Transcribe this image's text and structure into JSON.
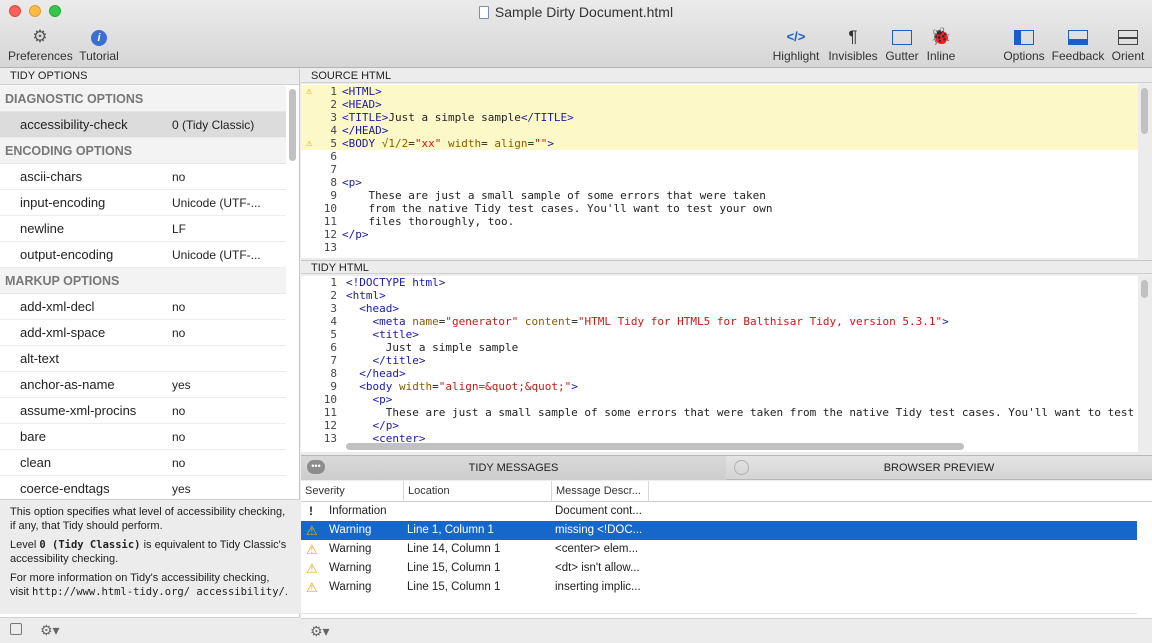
{
  "window": {
    "title": "Sample Dirty Document.html"
  },
  "toolbar": {
    "left": [
      {
        "label": "Preferences",
        "icon": "gear-icon"
      },
      {
        "label": "Tutorial",
        "icon": "info-icon"
      }
    ],
    "right": [
      {
        "label": "Highlight",
        "icon": "code-brackets-icon"
      },
      {
        "label": "Invisibles",
        "icon": "pilcrow-icon"
      },
      {
        "label": "Gutter",
        "icon": "gutter-icon"
      },
      {
        "label": "Inline",
        "icon": "bug-icon"
      },
      {
        "label": "Options",
        "icon": "options-panel-icon"
      },
      {
        "label": "Feedback",
        "icon": "feedback-panel-icon"
      },
      {
        "label": "Orient",
        "icon": "orient-icon"
      }
    ]
  },
  "left_pane": {
    "header": "TIDY OPTIONS",
    "groups": [
      {
        "title": "DIAGNOSTIC OPTIONS",
        "options": [
          {
            "name": "accessibility-check",
            "value": "0 (Tidy Classic)",
            "selected": true
          }
        ]
      },
      {
        "title": "ENCODING OPTIONS",
        "options": [
          {
            "name": "ascii-chars",
            "value": "no"
          },
          {
            "name": "input-encoding",
            "value": "Unicode (UTF-..."
          },
          {
            "name": "newline",
            "value": "LF"
          },
          {
            "name": "output-encoding",
            "value": "Unicode (UTF-..."
          }
        ]
      },
      {
        "title": "MARKUP OPTIONS",
        "options": [
          {
            "name": "add-xml-decl",
            "value": "no"
          },
          {
            "name": "add-xml-space",
            "value": "no"
          },
          {
            "name": "alt-text",
            "value": ""
          },
          {
            "name": "anchor-as-name",
            "value": "yes"
          },
          {
            "name": "assume-xml-procins",
            "value": "no"
          },
          {
            "name": "bare",
            "value": "no"
          },
          {
            "name": "clean",
            "value": "no"
          },
          {
            "name": "coerce-endtags",
            "value": "yes"
          }
        ]
      }
    ],
    "description": {
      "p1": "This option specifies what level of accessibility checking, if any, that Tidy should perform.",
      "p2_a": "Level ",
      "p2_code": "0 (Tidy Classic)",
      "p2_b": " is equivalent to Tidy Classic's accessibility checking.",
      "p3_a": "For more information on Tidy's accessibility checking, visit ",
      "p3_code": "http://www.html-tidy.org/ accessibility/",
      "p3_b": "."
    }
  },
  "source_pane": {
    "header": "SOURCE HTML",
    "lines": [
      {
        "n": "1",
        "warn": true,
        "hl": true,
        "html": "<span class='tag'>&lt;HTML&gt;</span>"
      },
      {
        "n": "2",
        "warn": false,
        "hl": true,
        "html": "<span class='tag'>&lt;HEAD&gt;</span>"
      },
      {
        "n": "3",
        "warn": false,
        "hl": true,
        "html": "<span class='tag'>&lt;TITLE&gt;</span>Just a simple sample<span class='tag'>&lt;/TITLE&gt;</span>"
      },
      {
        "n": "4",
        "warn": false,
        "hl": true,
        "html": "<span class='tag'>&lt;/HEAD&gt;</span>"
      },
      {
        "n": "5",
        "warn": true,
        "hl": true,
        "html": "<span class='tag'>&lt;BODY</span> <span class='attr'>√1/2</span>=<span class='str'>\"xx\"</span> <span class='attr'>width</span>= <span class='attr'>align</span>=<span class='str'>\"\"</span><span class='tag'>&gt;</span>"
      },
      {
        "n": "6",
        "warn": false,
        "hl": false,
        "html": ""
      },
      {
        "n": "7",
        "warn": false,
        "hl": false,
        "html": ""
      },
      {
        "n": "8",
        "warn": false,
        "hl": false,
        "html": "<span class='tag'>&lt;p&gt;</span>"
      },
      {
        "n": "9",
        "warn": false,
        "hl": false,
        "html": "    These are just a small sample of some errors that were taken"
      },
      {
        "n": "10",
        "warn": false,
        "hl": false,
        "html": "    from the native Tidy test cases. You'll want to test your own"
      },
      {
        "n": "11",
        "warn": false,
        "hl": false,
        "html": "    files thoroughly, too."
      },
      {
        "n": "12",
        "warn": false,
        "hl": false,
        "html": "<span class='tag'>&lt;/p&gt;</span>"
      },
      {
        "n": "13",
        "warn": false,
        "hl": false,
        "html": ""
      }
    ]
  },
  "tidy_pane": {
    "header": "TIDY HTML",
    "lines": [
      {
        "n": "1",
        "html": "<span class='tag'>&lt;!DOCTYPE html&gt;</span>"
      },
      {
        "n": "2",
        "html": "<span class='tag'>&lt;html&gt;</span>"
      },
      {
        "n": "3",
        "html": "  <span class='tag'>&lt;head&gt;</span>"
      },
      {
        "n": "4",
        "html": "    <span class='tag'>&lt;meta</span> <span class='attr'>name</span>=<span class='str'>\"generator\"</span> <span class='attr'>content</span>=<span class='str'>\"HTML Tidy for HTML5 for Balthisar Tidy, version 5.3.1\"</span><span class='tag'>&gt;</span>"
      },
      {
        "n": "5",
        "html": "    <span class='tag'>&lt;title&gt;</span>"
      },
      {
        "n": "6",
        "html": "      Just a simple sample"
      },
      {
        "n": "7",
        "html": "    <span class='tag'>&lt;/title&gt;</span>"
      },
      {
        "n": "8",
        "html": "  <span class='tag'>&lt;/head&gt;</span>"
      },
      {
        "n": "9",
        "html": "  <span class='tag'>&lt;body</span> <span class='attr'>width</span>=<span class='str'>\"align=&amp;quot;&amp;quot;\"</span><span class='tag'>&gt;</span>"
      },
      {
        "n": "10",
        "html": "    <span class='tag'>&lt;p&gt;</span>"
      },
      {
        "n": "11",
        "html": "      These are just a small sample of some errors that were taken from the native Tidy test cases. You'll want to test"
      },
      {
        "n": "12",
        "html": "    <span class='tag'>&lt;/p&gt;</span>"
      },
      {
        "n": "13",
        "html": "    <span class='tag'>&lt;center&gt;</span>"
      }
    ]
  },
  "messages": {
    "tabs": [
      {
        "label": "TIDY MESSAGES",
        "active": true
      },
      {
        "label": "BROWSER PREVIEW",
        "active": false
      }
    ],
    "columns": [
      "Severity",
      "Location",
      "Message Descr..."
    ],
    "rows": [
      {
        "severity": "Information",
        "kind": "info",
        "location": "",
        "message": "Document cont...",
        "selected": false
      },
      {
        "severity": "Warning",
        "kind": "warn",
        "location": "Line 1, Column 1",
        "message": "missing <!DOC...",
        "selected": true
      },
      {
        "severity": "Warning",
        "kind": "warn",
        "location": "Line 14, Column 1",
        "message": "<center> elem...",
        "selected": false
      },
      {
        "severity": "Warning",
        "kind": "warn",
        "location": "Line 15, Column 1",
        "message": "<dt> isn't allow...",
        "selected": false
      },
      {
        "severity": "Warning",
        "kind": "warn",
        "location": "Line 15, Column 1",
        "message": "inserting implic...",
        "selected": false
      }
    ]
  },
  "colors": {
    "selection": "#1766c9",
    "warning": "#e8a100",
    "highlight": "#fdf8c8"
  }
}
